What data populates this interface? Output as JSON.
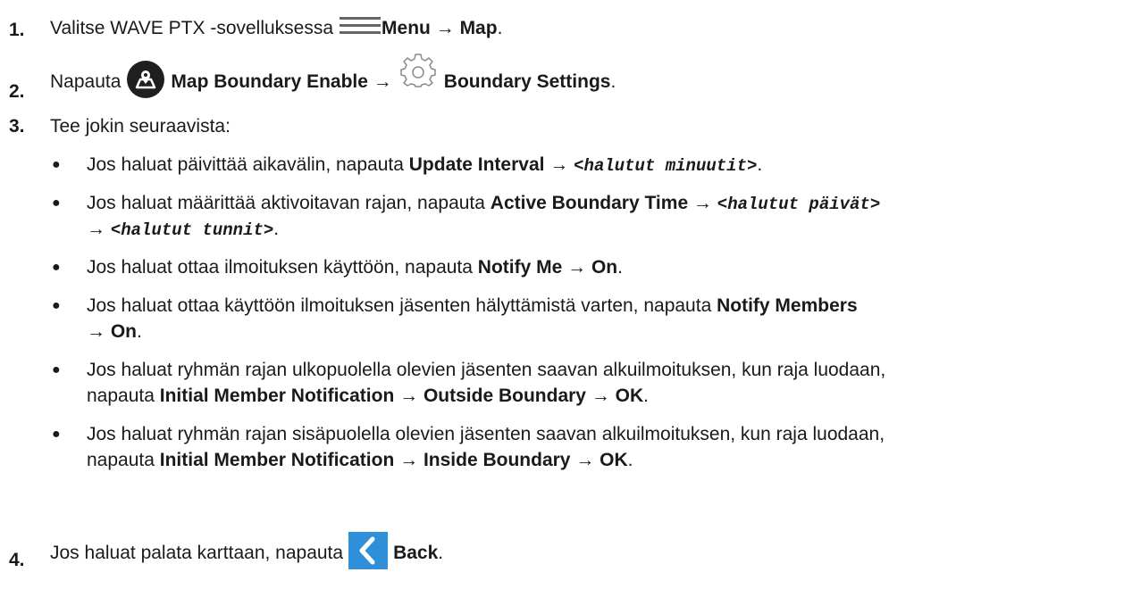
{
  "steps": [
    {
      "number": "1.",
      "pre": "Valitse WAVE PTX -sovelluksessa",
      "icon": "menu-icon",
      "b1": "Menu",
      "arrow": "→",
      "b2": "Map",
      "end": "."
    },
    {
      "number": "2.",
      "pre": "Napauta",
      "icon1": "map-boundary-icon",
      "b1": "Map Boundary Enable",
      "arrow": "→",
      "icon2": "gear-icon",
      "b2": "Boundary Settings",
      "end": "."
    },
    {
      "number": "3.",
      "text": "Tee jokin seuraavista:"
    },
    {
      "number": "4.",
      "pre": "Jos haluat palata karttaan, napauta",
      "icon": "back-icon",
      "b1": "Back",
      "end": "."
    }
  ],
  "bullets": [
    {
      "symbol": "●",
      "t1": "Jos haluat päivittää aikavälin, napauta ",
      "b1": "Update Interval",
      "a1": " → ",
      "m1": "<halutut minuutit>",
      "end": "."
    },
    {
      "symbol": "●",
      "t1": "Jos haluat määrittää aktivoitavan rajan, napauta ",
      "b1": "Active Boundary Time",
      "a1": " → ",
      "m1": "<halutut päivät>",
      "a2": "→ ",
      "m2": "<halutut tunnit>",
      "end": "."
    },
    {
      "symbol": "●",
      "t1": "Jos haluat ottaa ilmoituksen käyttöön, napauta ",
      "b1": "Notify Me",
      "a1": " → ",
      "b2": "On",
      "end": "."
    },
    {
      "symbol": "●",
      "t1": "Jos haluat ottaa käyttöön ilmoituksen jäsenten hälyttämistä varten, napauta ",
      "b1": "Notify Members",
      "a2": "→ ",
      "b2": "On",
      "end": "."
    },
    {
      "symbol": "●",
      "t1": "Jos haluat ryhmän rajan ulkopuolella olevien jäsenten saavan alkuilmoituksen, kun raja luodaan,",
      "t2": "napauta ",
      "b1": "Initial Member Notification",
      "a1": " → ",
      "b2": "Outside Boundary",
      "a2": " → ",
      "b3": "OK",
      "end": "."
    },
    {
      "symbol": "●",
      "t1": "Jos haluat ryhmän rajan sisäpuolella olevien jäsenten saavan alkuilmoituksen, kun raja luodaan,",
      "t2": "napauta ",
      "b1": "Initial Member Notification",
      "a1": " → ",
      "b2": "Inside Boundary",
      "a2": " → ",
      "b3": "OK",
      "end": "."
    }
  ],
  "colors": {
    "text": "#1a1a1a",
    "map_icon_bg": "#1f1f1f",
    "back_icon_bg": "#2f8fd8",
    "gear_stroke": "#8a8a8a",
    "menu_icon": "#666666"
  }
}
